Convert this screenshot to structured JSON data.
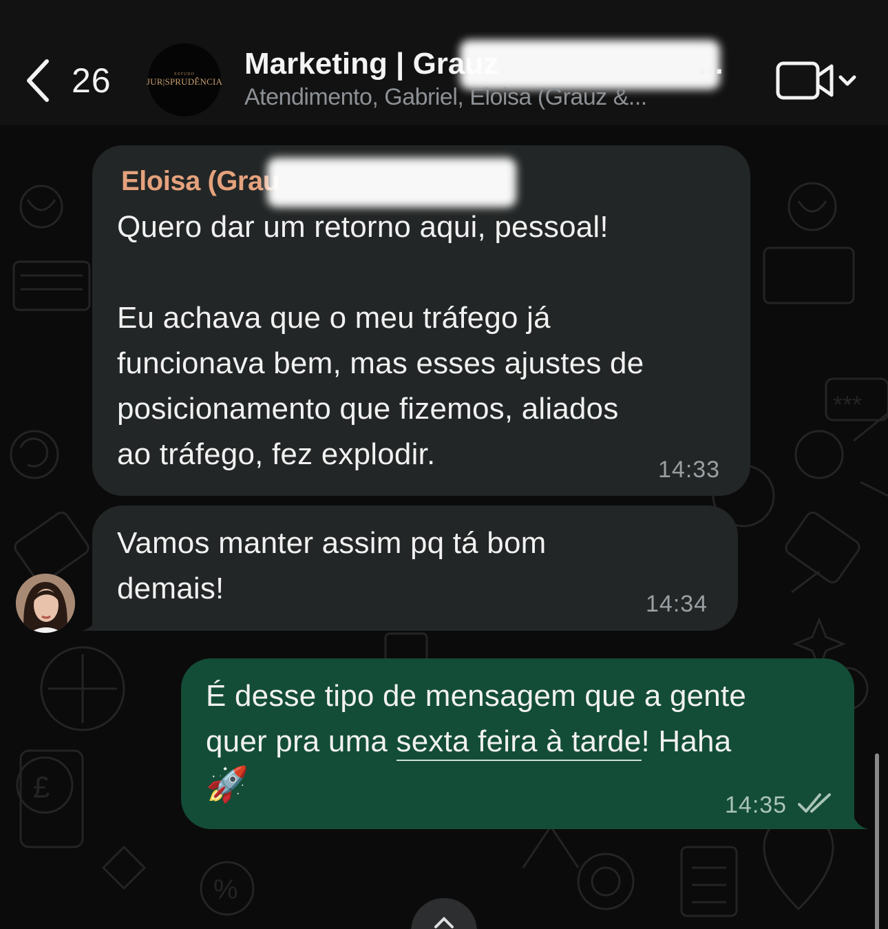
{
  "header": {
    "back_count": "26",
    "avatar_small_text": "ESTUDO",
    "avatar_brand": "JUR|SPRUDÊNCIA",
    "title": "Marketing | Grauz",
    "title_suffix": "...",
    "subtitle": "Atendimento, Gabriel, Eloisa (Grauz &..."
  },
  "messages": [
    {
      "direction": "incoming",
      "sender": "Eloisa (Grau",
      "text": "Quero dar um retorno aqui, pessoal!\n\nEu achava que o meu tráfego já\nfuncionava bem, mas esses ajustes de\nposicionamento que fizemos, aliados\nao tráfego, fez explodir.",
      "time": "14:33"
    },
    {
      "direction": "incoming",
      "text": "Vamos manter assim pq tá bom\ndemais!",
      "time": "14:34"
    },
    {
      "direction": "outgoing",
      "text_before": "É desse tipo de mensagem que a gente\nquer pra uma ",
      "link": "sexta feira à tarde",
      "text_after": "! Haha",
      "emoji": "🚀",
      "time": "14:35",
      "status": "read"
    }
  ],
  "colors": {
    "incoming_bubble": "#232626",
    "outgoing_bubble": "#144d37",
    "sender_name": "#e5a27d"
  },
  "icons": {
    "back": "chevron-left-icon",
    "video": "video-camera-icon",
    "dropdown": "chevron-down-icon",
    "read_receipt": "double-check-icon",
    "scroll_down": "arrow-down-icon"
  }
}
